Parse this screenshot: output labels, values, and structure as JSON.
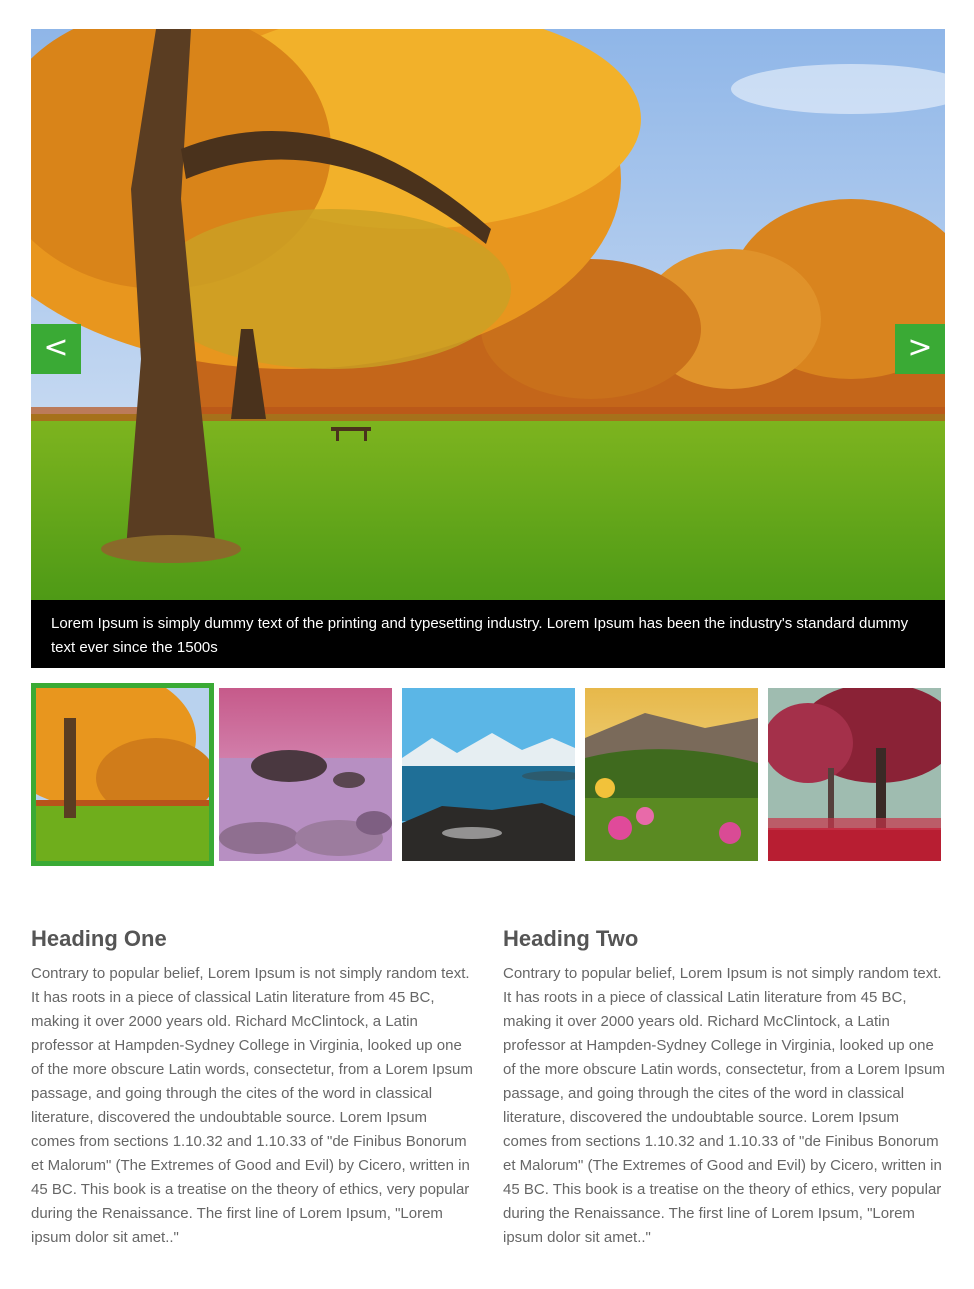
{
  "slider": {
    "prev_label": "<",
    "next_label": ">",
    "caption": "Lorem Ipsum is simply dummy text of the printing and typesetting industry. Lorem Ipsum has been the industry's standard dummy text ever since the 1500s",
    "accent_color": "#3aaa35",
    "main_image": "autumn-park-trees"
  },
  "thumbnails": [
    {
      "image": "autumn-park-trees",
      "active": true
    },
    {
      "image": "purple-seascape-rocks",
      "active": false
    },
    {
      "image": "mountain-lake-snow",
      "active": false
    },
    {
      "image": "sunset-hills-flowers",
      "active": false
    },
    {
      "image": "red-foggy-forest",
      "active": false
    }
  ],
  "columns": [
    {
      "heading": "Heading One",
      "body": "Contrary to popular belief, Lorem Ipsum is not simply random text. It has roots in a piece of classical Latin literature from 45 BC, making it over 2000 years old. Richard McClintock, a Latin professor at Hampden-Sydney College in Virginia, looked up one of the more obscure Latin words, consectetur, from a Lorem Ipsum passage, and going through the cites of the word in classical literature, discovered the undoubtable source. Lorem Ipsum comes from sections 1.10.32 and 1.10.33 of \"de Finibus Bonorum et Malorum\" (The Extremes of Good and Evil) by Cicero, written in 45 BC. This book is a treatise on the theory of ethics, very popular during the Renaissance. The first line of Lorem Ipsum, \"Lorem ipsum dolor sit amet..\""
    },
    {
      "heading": "Heading Two",
      "body": "Contrary to popular belief, Lorem Ipsum is not simply random text. It has roots in a piece of classical Latin literature from 45 BC, making it over 2000 years old. Richard McClintock, a Latin professor at Hampden-Sydney College in Virginia, looked up one of the more obscure Latin words, consectetur, from a Lorem Ipsum passage, and going through the cites of the word in classical literature, discovered the undoubtable source. Lorem Ipsum comes from sections 1.10.32 and 1.10.33 of \"de Finibus Bonorum et Malorum\" (The Extremes of Good and Evil) by Cicero, written in 45 BC. This book is a treatise on the theory of ethics, very popular during the Renaissance. The first line of Lorem Ipsum, \"Lorem ipsum dolor sit amet..\""
    }
  ]
}
